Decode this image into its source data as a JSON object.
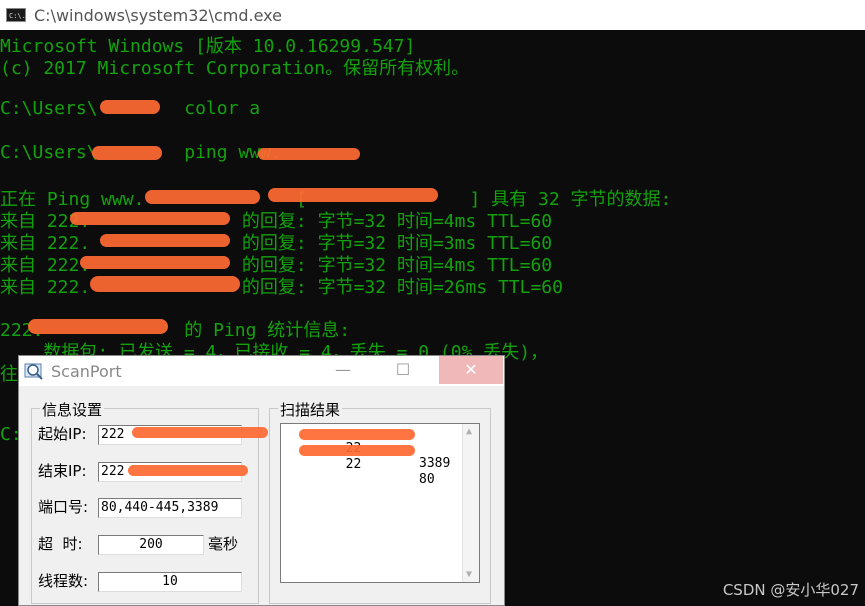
{
  "cmd": {
    "title": "C:\\windows\\system32\\cmd.exe",
    "icon_text": "C:\\.",
    "lines": [
      "Microsoft Windows [版本 10.0.16299.547]",
      "(c) 2017 Microsoft Corporation。保留所有权利。",
      "C:\\Users\\        color a",
      "C:\\Users\\        ping www.",
      "正在 Ping www.              [               ] 具有 32 字节的数据:",
      "来自 222.              的回复: 字节=32 时间=4ms TTL=60",
      "来自 222.              的回复: 字节=32 时间=3ms TTL=60",
      "来自 222.              的回复: 字节=32 时间=4ms TTL=60",
      "来自 222.              的回复: 字节=32 时间=26ms TTL=60",
      "222.             的 Ping 统计信息:",
      "    数据包: 已发送 = 4，已接收 = 4，丢失 = 0 (0% 丢失)，",
      "往",
      "C:"
    ]
  },
  "scanport": {
    "title": "ScanPort",
    "min_glyph": "—",
    "max_glyph": "☐",
    "close_glyph": "✕",
    "info_group_title": "信息设置",
    "results_group_title": "扫描结果",
    "start_ip_label": "起始IP:",
    "start_ip_value": "222",
    "end_ip_label": "结束IP:",
    "end_ip_value": "222",
    "port_label": "端口号:",
    "port_value": "80,440-445,3389",
    "timeout_label": "超  时:",
    "timeout_value": "200",
    "timeout_unit": "毫秒",
    "threads_label": "线程数:",
    "threads_value": "10",
    "results": [
      {
        "ip": "22",
        "port": "3389"
      },
      {
        "ip": "22",
        "port": "80"
      }
    ]
  },
  "watermark": "CSDN @安小华027",
  "colors": {
    "console_text": "#13a10e",
    "console_bg": "#0c0c0c",
    "redaction": "#ff6a33"
  }
}
